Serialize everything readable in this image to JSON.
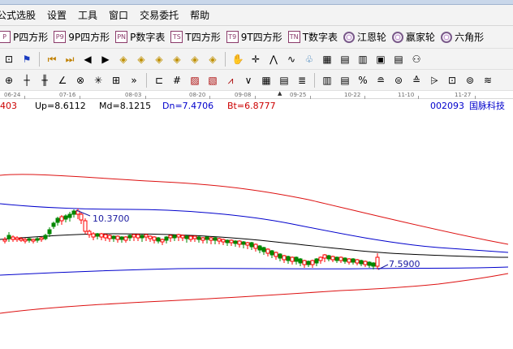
{
  "menubar": {
    "items": [
      "公式选股",
      "设置",
      "工具",
      "窗口",
      "交易委托",
      "帮助"
    ]
  },
  "draw_tools": [
    {
      "badge": "P",
      "label": "P四方形",
      "icon": "p-square-icon"
    },
    {
      "badge": "P9",
      "label": "9P四方形",
      "icon": "p9-square-icon"
    },
    {
      "badge": "PN",
      "label": "P数字表",
      "icon": "pn-table-icon"
    },
    {
      "badge": "TS",
      "label": "T四方形",
      "icon": "ts-square-icon"
    },
    {
      "badge": "T9",
      "label": "9T四方形",
      "icon": "t9-square-icon"
    },
    {
      "badge": "TN",
      "label": "T数字表",
      "icon": "tn-table-icon"
    },
    {
      "badge": "",
      "label": "江恩轮",
      "icon": "gann-wheel-icon"
    },
    {
      "badge": "",
      "label": "嬴家轮",
      "icon": "winner-wheel-icon"
    },
    {
      "badge": "",
      "label": "六角形",
      "icon": "hexagon-icon"
    }
  ],
  "nav_toolbar": {
    "icons": [
      "zoom-icon",
      "flag-icon",
      "first-bar-icon",
      "last-bar-icon",
      "prev-icon",
      "next-icon",
      "diamond-left-icon",
      "diamond-up-icon",
      "diamond-down-icon",
      "diamond-right-icon",
      "diamond-up2-icon",
      "diamond-cross-icon",
      "hand-icon",
      "crosshair-icon",
      "zigzag-icon",
      "wave-icon",
      "rabbit-icon",
      "calendar-icon",
      "grid-table-icon",
      "chart-table-icon",
      "save-icon",
      "report-icon",
      "trader-icon"
    ]
  },
  "line_toolbar": {
    "icons": [
      "circle-cross-icon",
      "bars-icon",
      "bars-up-icon",
      "angle-icon",
      "target-icon",
      "snowflake-icon",
      "grid-box-icon",
      "more-icon",
      "hline-icon",
      "hash-icon",
      "hatch-icon",
      "square-hatch-icon",
      "fan-icon",
      "v-icon",
      "grid-icon",
      "fib-grid-icon",
      "lines-icon",
      "bar-table-icon",
      "table-edit-icon",
      "percent-icon",
      "fib-icon",
      "coin-icon",
      "fib-arc-icon",
      "up-stair-icon",
      "fib-box-icon",
      "ring-icon",
      "fib-retrace-icon"
    ]
  },
  "date_ruler": {
    "labels": [
      "06-24",
      "07-16",
      "08-03",
      "08-20",
      "09-08",
      "09-25",
      "10-22",
      "11-10",
      "11-27"
    ]
  },
  "info_bar": {
    "lead": "403",
    "up": "Up=8.6112",
    "md": "Md=8.1215",
    "dn": "Dn=7.4706",
    "bt": "Bt=6.8777",
    "code": "002093",
    "name": "国脉科技"
  },
  "annotations": {
    "high": "10.3700",
    "low": "7.5900"
  },
  "colors": {
    "up_band": "#dd1111",
    "mid_band": "#0000cc",
    "candle_up": "#ff0000",
    "candle_down": "#008800",
    "annotation": "#1a1aa0"
  }
}
